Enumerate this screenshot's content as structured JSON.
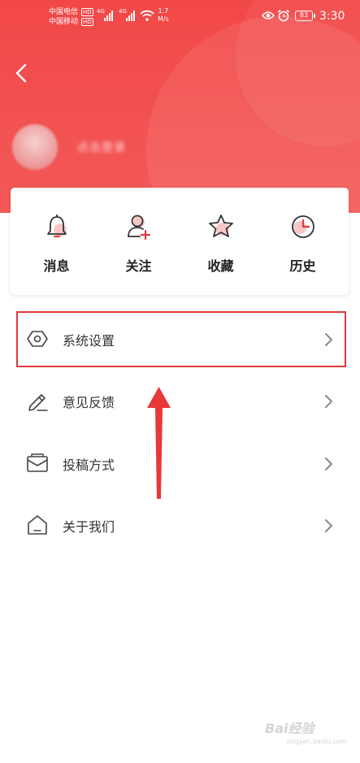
{
  "status_bar": {
    "carrier1": "中国电信",
    "carrier2": "中国移动",
    "hd": "HD",
    "net1": "4G",
    "net2": "4G",
    "speed_value": "1.7",
    "speed_unit": "M/s",
    "battery": "83",
    "time": "3:30"
  },
  "header": {
    "back_icon": "chevron-left-icon",
    "username": "点击登录"
  },
  "quick_actions": [
    {
      "label": "消息",
      "icon": "bell-icon"
    },
    {
      "label": "关注",
      "icon": "user-plus-icon"
    },
    {
      "label": "收藏",
      "icon": "star-icon"
    },
    {
      "label": "历史",
      "icon": "clock-icon"
    }
  ],
  "menu": [
    {
      "label": "系统设置",
      "icon": "settings-hexagon-icon"
    },
    {
      "label": "意见反馈",
      "icon": "pencil-icon"
    },
    {
      "label": "投稿方式",
      "icon": "mail-icon"
    },
    {
      "label": "关于我们",
      "icon": "home-icon"
    }
  ],
  "colors": {
    "accent": "#f24747",
    "highlight": "#e0393b"
  },
  "watermark": {
    "text": "Bai经验",
    "sub": "jingyan.baidu.com"
  }
}
